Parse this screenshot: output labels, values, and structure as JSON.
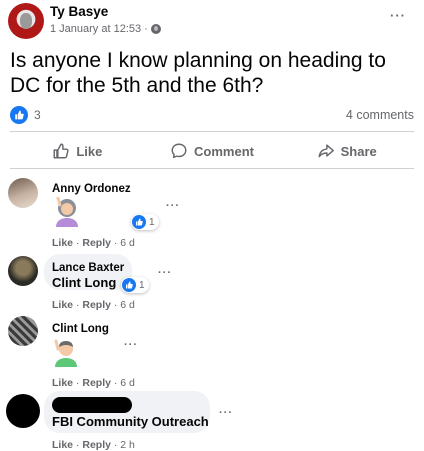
{
  "post": {
    "author": "Ty Basye",
    "timestamp": "1 January at 12:53",
    "separator": "·",
    "text": "Is anyone I know planning on heading to DC for the 5th and the 6th?",
    "reaction_count": "3",
    "comments_label": "4 comments",
    "more_label": "···"
  },
  "actions": {
    "like": "Like",
    "comment": "Comment",
    "share": "Share"
  },
  "comments": [
    {
      "name": "Anny Ordonez",
      "text": "",
      "sticker": "woman-raising-hand",
      "reaction_count": "1",
      "like": "Like",
      "reply": "Reply",
      "age": "6 d"
    },
    {
      "name": "Lance Baxter",
      "text": "Clint Long",
      "reaction_count": "1",
      "like": "Like",
      "reply": "Reply",
      "age": "6 d"
    },
    {
      "name": "Clint Long",
      "text": "",
      "sticker": "man-raising-hand",
      "like": "Like",
      "reply": "Reply",
      "age": "6 d"
    },
    {
      "name": "",
      "text": "FBI Community Outreach",
      "name_redacted": true,
      "like": "Like",
      "reply": "Reply",
      "age": "2 h"
    }
  ],
  "dot_sep": " · ",
  "more": "···",
  "colors": {
    "accent": "#1877f2",
    "secondary_text": "#65676b",
    "bubble": "#f0f2f5"
  }
}
